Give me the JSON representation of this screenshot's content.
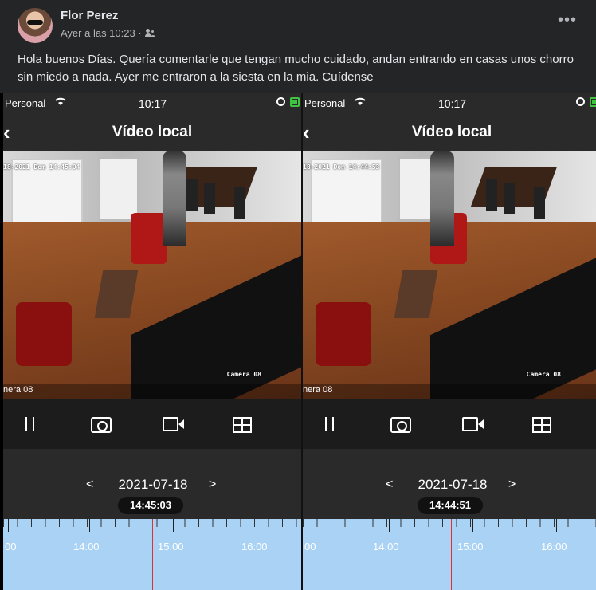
{
  "post": {
    "author": "Flor Perez",
    "timestamp": "Ayer a las 10:23 ·",
    "audience_icon": "friends-icon",
    "more_label": "•••",
    "text": "Hola buenos Días.  Quería comentarle que tengan mucho cuidado, andan entrando en casas unos chorro sin miedo a nada. Ayer me entraron a la siesta en la mia. Cuídense"
  },
  "phones": [
    {
      "status": {
        "carrier": "Personal",
        "time": "10:17"
      },
      "nav": {
        "back": "‹",
        "title": "Vídeo local"
      },
      "video": {
        "osd_timestamp": "18-2021 Dom 14:45:04",
        "osd_camera": "Camera 08",
        "camera_label": "nera 08"
      },
      "date_nav": {
        "prev": "<",
        "date": "2021-07-18",
        "next": ">",
        "time": "14:45:03"
      },
      "timeline": {
        "labels": [
          "00",
          "14:00",
          "15:00",
          "16:00"
        ]
      }
    },
    {
      "status": {
        "carrier": "Personal",
        "time": "10:17"
      },
      "nav": {
        "back": "‹",
        "title": "Vídeo local"
      },
      "video": {
        "osd_timestamp": "18-2021 Dom 14:44:53",
        "osd_camera": "Camera 08",
        "camera_label": "nera 08"
      },
      "date_nav": {
        "prev": "<",
        "date": "2021-07-18",
        "next": ">",
        "time": "14:44:51"
      },
      "timeline": {
        "labels": [
          "00",
          "14:00",
          "15:00",
          "16:00"
        ]
      }
    }
  ],
  "colors": {
    "background": "#242526",
    "timeline": "#a9d2f5",
    "cursor": "#e03030",
    "battery": "#3ec43e"
  }
}
